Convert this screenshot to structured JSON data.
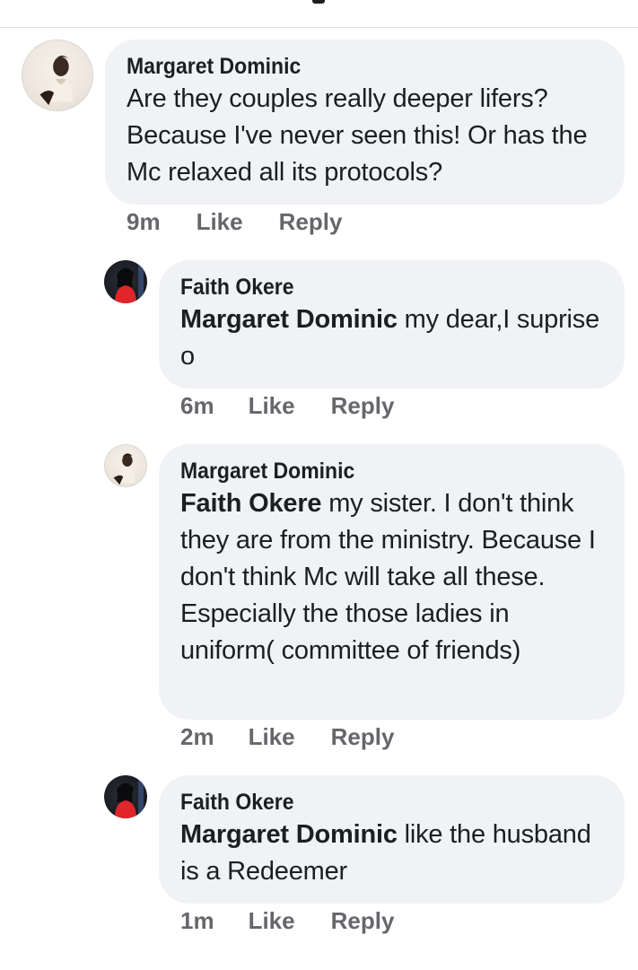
{
  "comments": [
    {
      "author": "Margaret Dominic",
      "mention": "",
      "text": "Are they couples really deeper lifers? Because I've never seen this! Or has the Mc relaxed all its protocols?",
      "time": "9m",
      "like_label": "Like",
      "reply_label": "Reply"
    },
    {
      "author": "Faith Okere",
      "mention": "Margaret Dominic",
      "text": " my dear,I suprise o",
      "time": "6m",
      "like_label": "Like",
      "reply_label": "Reply"
    },
    {
      "author": "Margaret Dominic",
      "mention": "Faith Okere",
      "text": " my sister. I don't think they are from the ministry. Because I don't think Mc will take all these. Especially the those ladies in uniform( committee of friends)",
      "time": "2m",
      "like_label": "Like",
      "reply_label": "Reply"
    },
    {
      "author": "Faith Okere",
      "mention": "Margaret Dominic",
      "text": " like the husband is a Redeemer",
      "time": "1m",
      "like_label": "Like",
      "reply_label": "Reply"
    }
  ],
  "colors": {
    "bubble": "#f0f2f5",
    "text": "#1c1e21",
    "meta": "#65676b"
  }
}
